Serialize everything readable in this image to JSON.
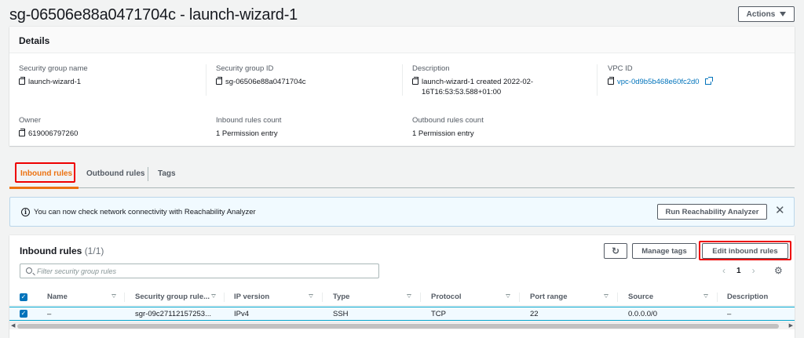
{
  "header": {
    "title": "sg-06506e88a0471704c - launch-wizard-1",
    "actions_label": "Actions"
  },
  "details": {
    "heading": "Details",
    "fields": {
      "sg_name": {
        "label": "Security group name",
        "value": "launch-wizard-1"
      },
      "sg_id": {
        "label": "Security group ID",
        "value": "sg-06506e88a0471704c"
      },
      "description": {
        "label": "Description",
        "value_line1": "launch-wizard-1 created 2022-02-",
        "value_line2": "16T16:53:53.588+01:00"
      },
      "vpc_id": {
        "label": "VPC ID",
        "value": "vpc-0d9b5b468e60fc2d0"
      },
      "owner": {
        "label": "Owner",
        "value": "619006797260"
      },
      "inbound_count": {
        "label": "Inbound rules count",
        "value": "1 Permission entry"
      },
      "outbound_count": {
        "label": "Outbound rules count",
        "value": "1 Permission entry"
      }
    }
  },
  "tabs": [
    {
      "label": "Inbound rules",
      "active": true
    },
    {
      "label": "Outbound rules",
      "active": false
    },
    {
      "label": "Tags",
      "active": false
    }
  ],
  "alert": {
    "info_glyph": "i",
    "text": "You can now check network connectivity with Reachability Analyzer",
    "button_label": "Run Reachability Analyzer",
    "close_glyph": "✕"
  },
  "rules_table": {
    "title": "Inbound rules",
    "count": "(1/1)",
    "refresh_glyph": "↻",
    "manage_tags_label": "Manage tags",
    "edit_label": "Edit inbound rules",
    "filter_placeholder": "Filter security group rules",
    "pager": {
      "prev": "‹",
      "page": "1",
      "next": "›"
    },
    "settings_glyph": "⚙",
    "checkbox_glyph": "✓",
    "columns": [
      "Name",
      "Security group rule...",
      "IP version",
      "Type",
      "Protocol",
      "Port range",
      "Source",
      "Description"
    ],
    "rows": [
      {
        "name": "–",
        "rule_id": "sgr-09c27112157253...",
        "ip_version": "IPv4",
        "type": "SSH",
        "protocol": "TCP",
        "port_range": "22",
        "source": "0.0.0.0/0",
        "description": "–"
      }
    ],
    "scroll_left": "◀",
    "scroll_right": "▶"
  },
  "colors": {
    "accent": "#ec7211",
    "link": "#0073bb",
    "highlight": "#e00000"
  }
}
